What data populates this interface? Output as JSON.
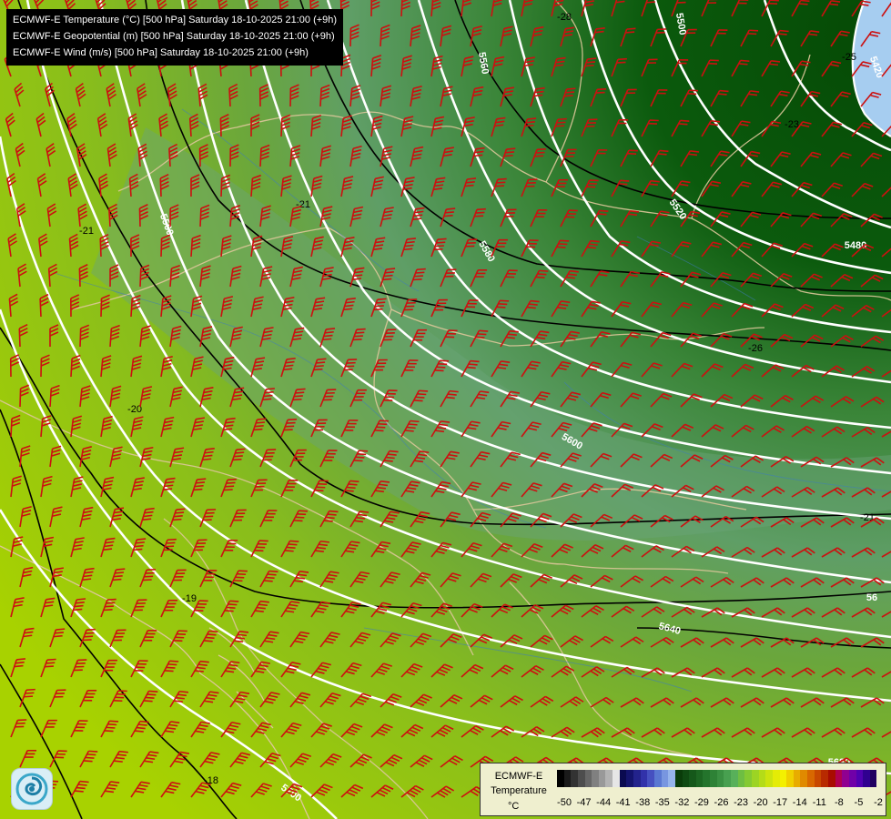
{
  "header": {
    "lines": [
      "ECMWF-E Temperature (°C) [500 hPa] Saturday 18-10-2025 21:00 (+9h)",
      "ECMWF-E Geopotential (m) [500 hPa] Saturday 18-10-2025 21:00 (+9h)",
      "ECMWF-E Wind (m/s) [500 hPa] Saturday 18-10-2025 21:00 (+9h)"
    ]
  },
  "logo_icon": "ecmwf-swirl-icon",
  "legend": {
    "title_line1": "ECMWF-E",
    "title_line2": "Temperature",
    "unit": "°C",
    "ticks": [
      "-50",
      "-47",
      "-44",
      "-41",
      "-38",
      "-35",
      "-32",
      "-29",
      "-26",
      "-23",
      "-20",
      "-17",
      "-14",
      "-11",
      "-8",
      "-5",
      "-2"
    ],
    "colors": [
      "#000000",
      "#1a1a1a",
      "#333333",
      "#4d4d4d",
      "#666666",
      "#808080",
      "#999999",
      "#b3b3b3",
      "#e6e6e6",
      "#0a0a50",
      "#14146e",
      "#23238c",
      "#3232aa",
      "#4650c0",
      "#5a78d2",
      "#7896e0",
      "#96b4ec",
      "#0a3c0a",
      "#0f4a12",
      "#15581a",
      "#1c6622",
      "#24742c",
      "#2e8236",
      "#3a9042",
      "#48a050",
      "#58b05a",
      "#6ebe42",
      "#84ca32",
      "#9cd424",
      "#b4dc18",
      "#cce40e",
      "#e4ec06",
      "#f4f000",
      "#f0d000",
      "#e8ac00",
      "#e08a00",
      "#d86800",
      "#c84800",
      "#b82a00",
      "#a80c00",
      "#b00050",
      "#900090",
      "#7000a8",
      "#5000b0",
      "#300090",
      "#200060"
    ]
  },
  "map": {
    "geopotential_labels": [
      "5420",
      "5480",
      "5500",
      "5520",
      "5560",
      "5560",
      "5580",
      "5600",
      "5640",
      "5680",
      "5700",
      "56"
    ],
    "temperature_labels": [
      "-28",
      "-26",
      "-21",
      "-21",
      "-20",
      "-19",
      "-18",
      "-21",
      "-23",
      "-25"
    ],
    "colors": {
      "temp_dark": "#075307",
      "temp_mid": "#3f8a3c",
      "temp_pale": "#61a06d",
      "temp_yellowgreen": "#8bbd1c",
      "temp_lime": "#a6d000",
      "cold_blue": "#a6cdf0",
      "isohypse": "#ffffff",
      "isotherm": "#000000",
      "wind_barb": "#cc1010",
      "borders": "#ddc79a"
    }
  }
}
